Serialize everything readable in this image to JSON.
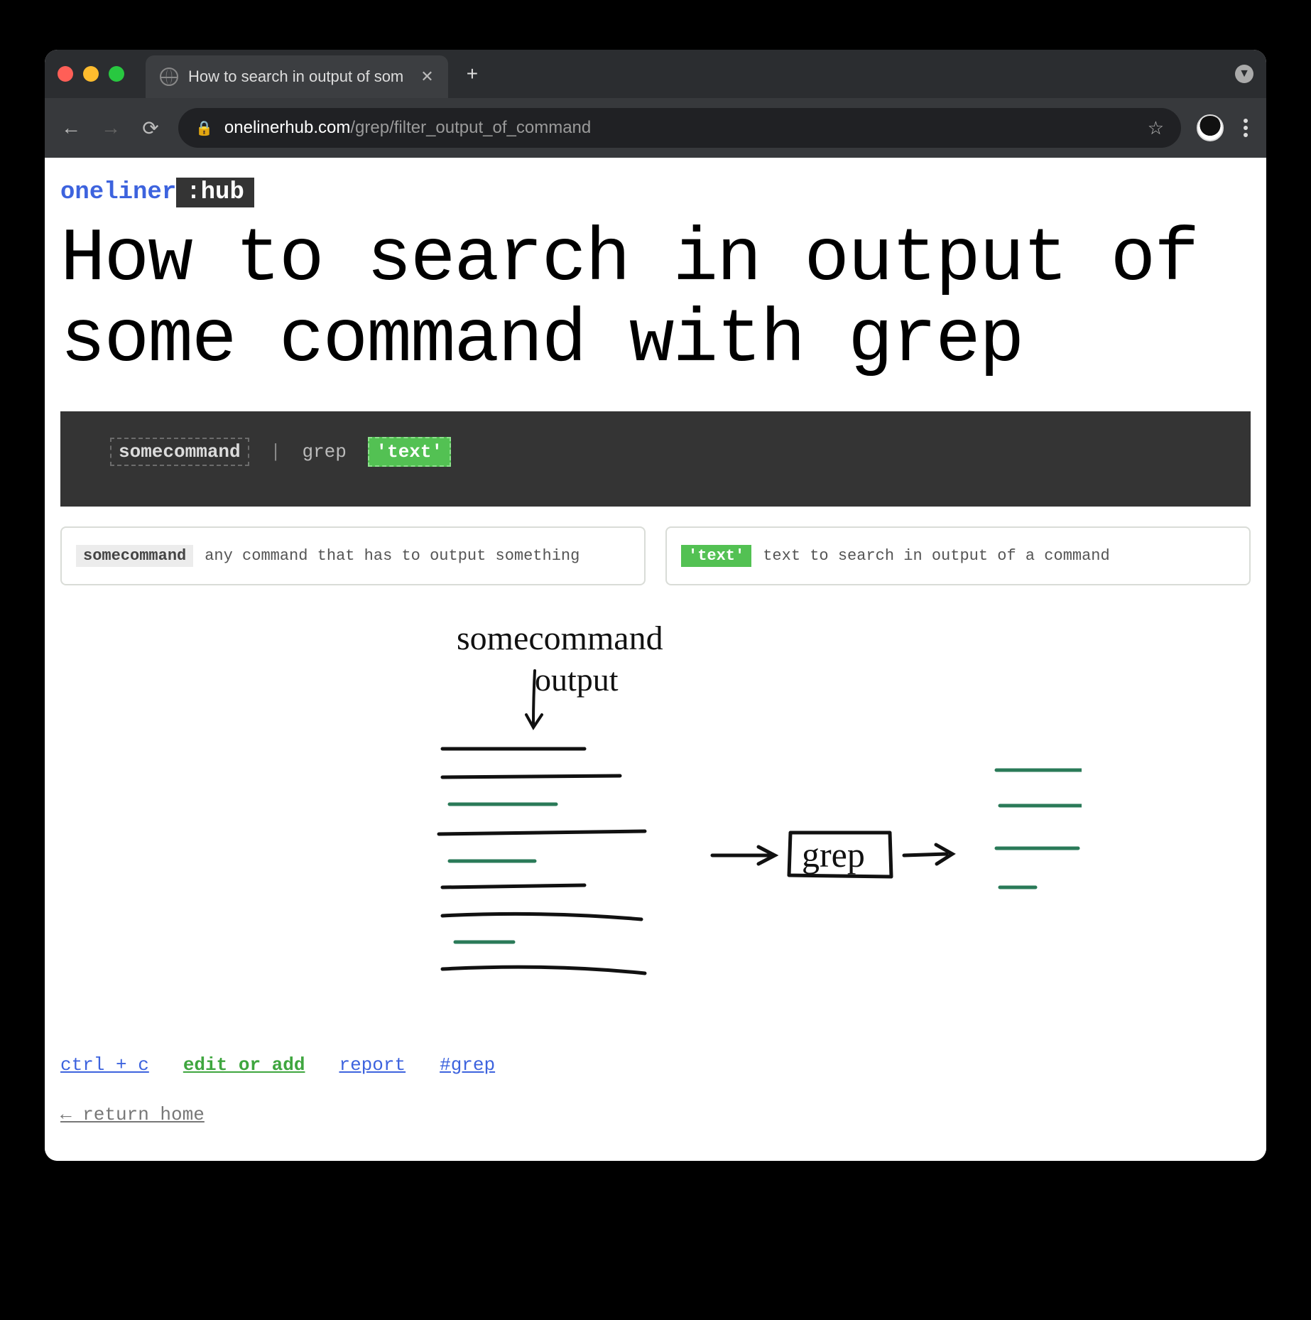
{
  "tab": {
    "title": "How to search in output of som"
  },
  "address": {
    "domain": "onelinerhub.com",
    "path": "/grep/filter_output_of_command"
  },
  "logo": {
    "part1": "oneliner",
    "part2": ":hub"
  },
  "page": {
    "title": "How to search in output of some command with grep"
  },
  "code": {
    "command": "somecommand",
    "pipe": "|",
    "grep": "grep",
    "text": "'text'"
  },
  "explanations": [
    {
      "chip": "somecommand",
      "desc": "any command that has to output something"
    },
    {
      "chip": "'text'",
      "desc": "text to search in output of a command"
    }
  ],
  "diagram": {
    "title": "somecommand",
    "subtitle": "output",
    "box": "grep"
  },
  "links": {
    "copy": "ctrl + c",
    "edit": "edit or add",
    "report": "report",
    "tag": "#grep"
  },
  "return_home": "← return home"
}
